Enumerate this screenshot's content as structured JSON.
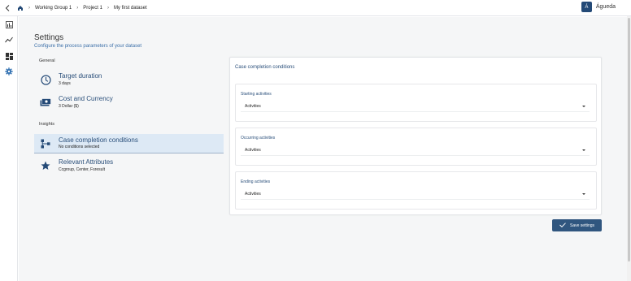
{
  "breadcrumb": {
    "home_icon": "home-icon",
    "items": [
      "Working Group 1",
      "Project 1",
      "My first dataset"
    ]
  },
  "user": {
    "initial": "Á",
    "name": "Águeda"
  },
  "sidebar": {
    "icons": [
      "chart-bar-icon",
      "trend-line-icon",
      "dashboard-icon",
      "gear-icon"
    ]
  },
  "page": {
    "title": "Settings",
    "subtitle": "Configure the process parameters of your dataset"
  },
  "groups": {
    "general": "General",
    "insights": "Insights"
  },
  "items": [
    {
      "name": "Target duration",
      "desc": "3 days",
      "icon": "clock-icon"
    },
    {
      "name": "Cost and Currency",
      "desc": "3 Dollar ($)",
      "icon": "money-icon"
    },
    {
      "name": "Case completion conditions",
      "desc": "No conditions selected",
      "icon": "flow-icon"
    },
    {
      "name": "Relevant Attributes",
      "desc": "Ccgroup, Center, Fsresult",
      "icon": "star-icon"
    }
  ],
  "conditions": {
    "title": "Case completion conditions",
    "sections": [
      {
        "label": "Starting activities",
        "value": "Activities"
      },
      {
        "label": "Occurring activities",
        "value": "Activities"
      },
      {
        "label": "Ending activities",
        "value": "Activities"
      }
    ]
  },
  "save_label": "Save settings",
  "colors": {
    "accent": "#30567f",
    "link": "#3b6fa8",
    "active_bg": "#dde9f5"
  }
}
